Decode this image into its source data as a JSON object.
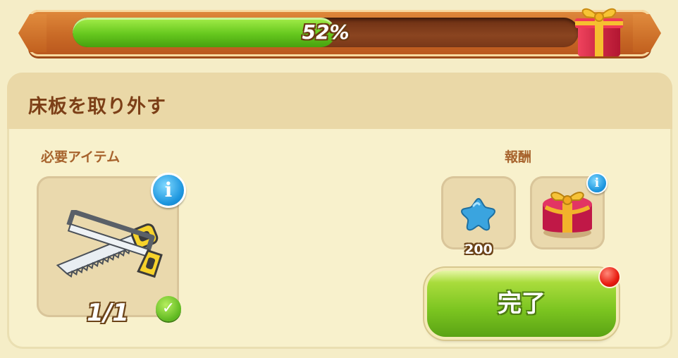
{
  "progress": {
    "value": 0.52,
    "label": "52%"
  },
  "task": {
    "title": "床板を取り外す"
  },
  "required": {
    "heading": "必要アイテム",
    "item": {
      "icon": "saw-icon",
      "count": "1/1",
      "complete": true
    }
  },
  "rewards": {
    "heading": "報酬",
    "items": [
      {
        "icon": "blue-star-icon",
        "amount": "200"
      },
      {
        "icon": "gift-box-icon"
      }
    ]
  },
  "actions": {
    "complete_label": "完了"
  },
  "colors": {
    "accent_green": "#7bc420",
    "header_orange": "#c96a26",
    "title_brown": "#7c3f17"
  }
}
